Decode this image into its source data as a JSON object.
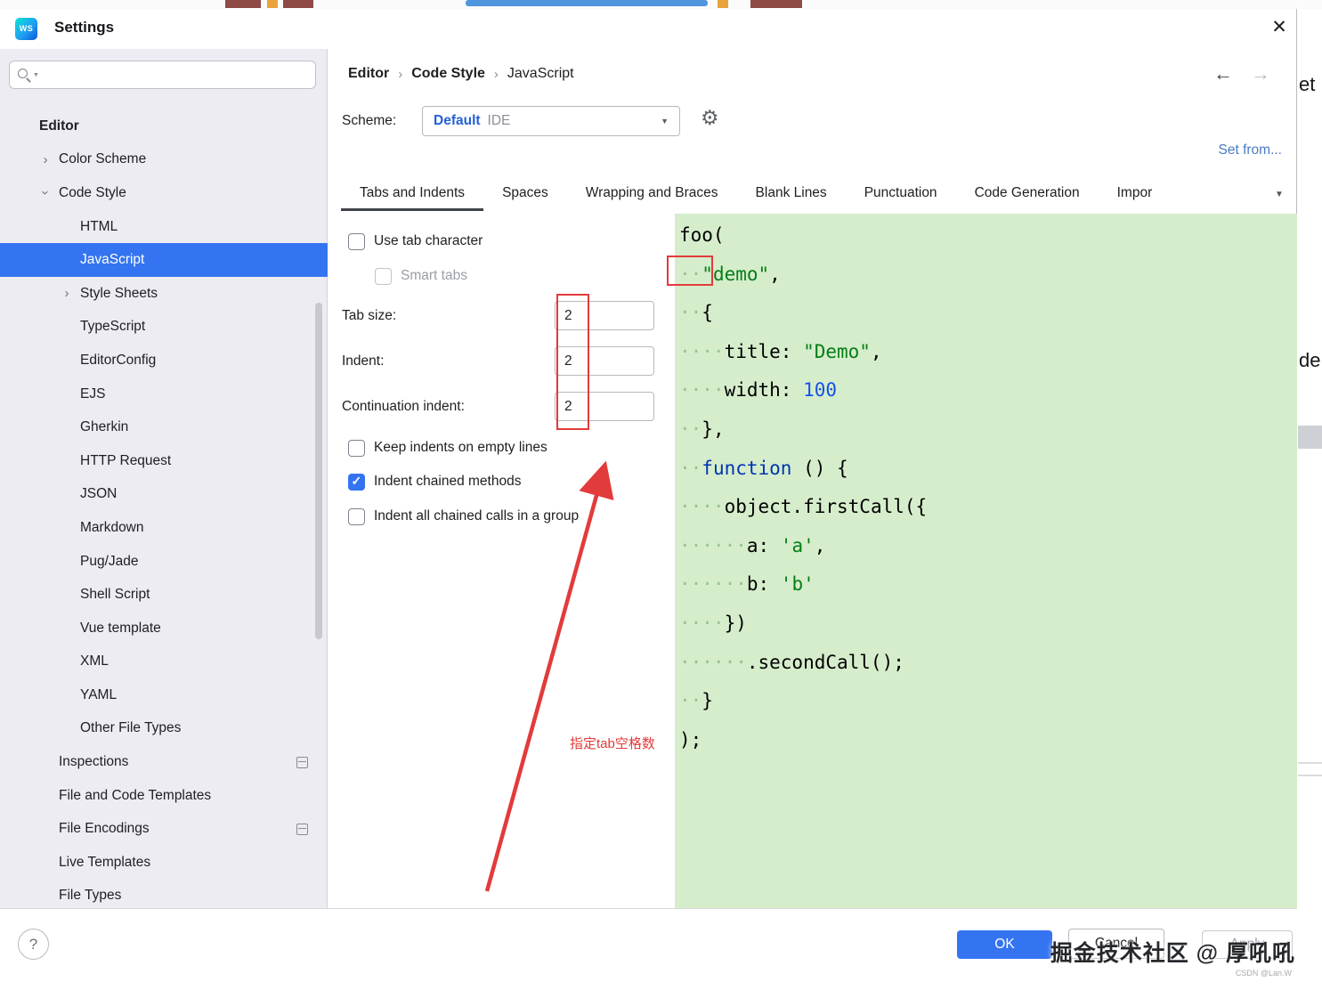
{
  "window": {
    "title": "Settings"
  },
  "icons": {
    "close": "✕",
    "gear": "⚙",
    "back": "←",
    "forward": "→",
    "chevron": "›",
    "dropdown": "▼",
    "help": "?",
    "logo_text": "WS"
  },
  "sidebar": {
    "items": [
      {
        "label": "Editor",
        "level": 0,
        "bold": true
      },
      {
        "label": "Color Scheme",
        "level": 1,
        "chevron": "collapsed"
      },
      {
        "label": "Code Style",
        "level": 1,
        "chevron": "expanded"
      },
      {
        "label": "HTML",
        "level": 2
      },
      {
        "label": "JavaScript",
        "level": 2,
        "selected": true
      },
      {
        "label": "Style Sheets",
        "level": 2,
        "chevron": "collapsed"
      },
      {
        "label": "TypeScript",
        "level": 2
      },
      {
        "label": "EditorConfig",
        "level": 2
      },
      {
        "label": "EJS",
        "level": 2
      },
      {
        "label": "Gherkin",
        "level": 2
      },
      {
        "label": "HTTP Request",
        "level": 2
      },
      {
        "label": "JSON",
        "level": 2
      },
      {
        "label": "Markdown",
        "level": 2
      },
      {
        "label": "Pug/Jade",
        "level": 2
      },
      {
        "label": "Shell Script",
        "level": 2
      },
      {
        "label": "Vue template",
        "level": 2
      },
      {
        "label": "XML",
        "level": 2
      },
      {
        "label": "YAML",
        "level": 2
      },
      {
        "label": "Other File Types",
        "level": 2
      },
      {
        "label": "Inspections",
        "level": 1,
        "trailing_icon": true
      },
      {
        "label": "File and Code Templates",
        "level": 1
      },
      {
        "label": "File Encodings",
        "level": 1,
        "trailing_icon": true
      },
      {
        "label": "Live Templates",
        "level": 1
      },
      {
        "label": "File Types",
        "level": 1
      }
    ]
  },
  "header": {
    "breadcrumb": [
      "Editor",
      "Code Style",
      "JavaScript"
    ],
    "separator": "›",
    "scheme_label": "Scheme:",
    "scheme_value": "Default",
    "scheme_suffix": "IDE",
    "set_from": "Set from..."
  },
  "tabs": [
    {
      "label": "Tabs and Indents",
      "active": true
    },
    {
      "label": "Spaces"
    },
    {
      "label": "Wrapping and Braces"
    },
    {
      "label": "Blank Lines"
    },
    {
      "label": "Punctuation"
    },
    {
      "label": "Code Generation"
    },
    {
      "label": "Impor",
      "truncated": true
    }
  ],
  "form": {
    "use_tab_character": {
      "label": "Use tab character",
      "checked": false
    },
    "smart_tabs": {
      "label": "Smart tabs",
      "checked": false,
      "disabled": true
    },
    "tab_size": {
      "label": "Tab size:",
      "value": "2"
    },
    "indent": {
      "label": "Indent:",
      "value": "2"
    },
    "continuation_indent": {
      "label": "Continuation indent:",
      "value": "2"
    },
    "keep_indents": {
      "label": "Keep indents on empty lines",
      "checked": false
    },
    "indent_chained": {
      "label": "Indent chained methods",
      "checked": true
    },
    "indent_all_chained": {
      "label": "Indent all chained calls in a group",
      "checked": false
    }
  },
  "annotations": {
    "note_text": "指定tab空格数",
    "color": "#e23b3b"
  },
  "preview": {
    "background": "#d5edcb",
    "colors": {
      "string": "#067d17",
      "number": "#1750eb",
      "keyword": "#0033b3",
      "plain": "#000000"
    },
    "lines": [
      [
        {
          "t": "foo(",
          "c": "plain"
        }
      ],
      [
        {
          "t": "  ",
          "c": "ws"
        },
        {
          "t": "\"demo\"",
          "c": "string"
        },
        {
          "t": ",",
          "c": "plain"
        }
      ],
      [
        {
          "t": "  ",
          "c": "ws"
        },
        {
          "t": "{",
          "c": "plain"
        }
      ],
      [
        {
          "t": "    ",
          "c": "ws"
        },
        {
          "t": "title: ",
          "c": "plain"
        },
        {
          "t": "\"Demo\"",
          "c": "string"
        },
        {
          "t": ",",
          "c": "plain"
        }
      ],
      [
        {
          "t": "    ",
          "c": "ws"
        },
        {
          "t": "width: ",
          "c": "plain"
        },
        {
          "t": "100",
          "c": "number"
        }
      ],
      [
        {
          "t": "  ",
          "c": "ws"
        },
        {
          "t": "},",
          "c": "plain"
        }
      ],
      [
        {
          "t": "  ",
          "c": "ws"
        },
        {
          "t": "function",
          "c": "keyword"
        },
        {
          "t": " () {",
          "c": "plain"
        }
      ],
      [
        {
          "t": "    ",
          "c": "ws"
        },
        {
          "t": "object.firstCall({",
          "c": "plain"
        }
      ],
      [
        {
          "t": "      ",
          "c": "ws"
        },
        {
          "t": "a: ",
          "c": "plain"
        },
        {
          "t": "'a'",
          "c": "string"
        },
        {
          "t": ",",
          "c": "plain"
        }
      ],
      [
        {
          "t": "      ",
          "c": "ws"
        },
        {
          "t": "b: ",
          "c": "plain"
        },
        {
          "t": "'b'",
          "c": "string"
        }
      ],
      [
        {
          "t": "    ",
          "c": "ws"
        },
        {
          "t": "})",
          "c": "plain"
        }
      ],
      [
        {
          "t": "      ",
          "c": "ws"
        },
        {
          "t": ".secondCall();",
          "c": "plain"
        }
      ],
      [
        {
          "t": "  ",
          "c": "ws"
        },
        {
          "t": "}",
          "c": "plain"
        }
      ],
      [
        {
          "t": ");",
          "c": "plain"
        }
      ]
    ]
  },
  "footer": {
    "ok": "OK",
    "cancel": "Cancel",
    "apply": "Apply"
  },
  "watermark": {
    "text": "掘金技术社区 @ 厚吼吼",
    "sub": "CSDN @Lan.W"
  },
  "background": {
    "fragments": [
      "et",
      "de"
    ]
  },
  "colors": {
    "accent": "#3574f0",
    "annotation_red": "#e23b3b",
    "sidebar_bg": "#edecf2"
  }
}
